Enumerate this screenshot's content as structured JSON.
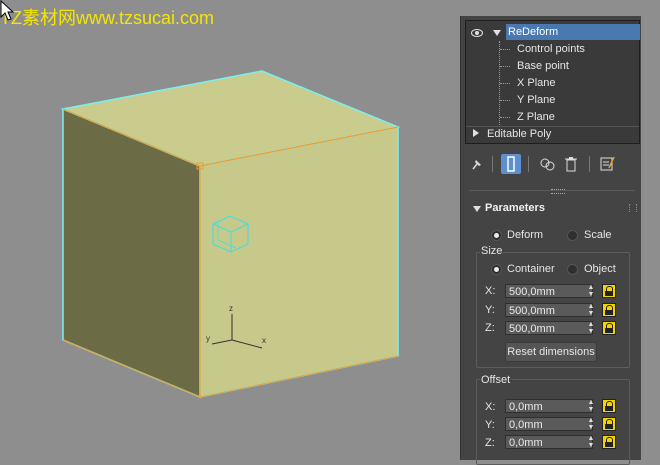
{
  "watermark": "TZ素材网www.tzsucai.com",
  "stack": {
    "modifier": "ReDeform",
    "subitems": [
      "Control points",
      "Base point",
      "X Plane",
      "Y Plane",
      "Z Plane"
    ],
    "base_object": "Editable Poly"
  },
  "toolbar": {
    "icons": [
      "pin-stack-icon",
      "show-end-result-icon",
      "make-unique-icon",
      "remove-modifier-icon",
      "configure-sets-icon"
    ]
  },
  "parameters": {
    "title": "Parameters",
    "mode_options": [
      "Deform",
      "Scale"
    ],
    "mode_selected": "Deform",
    "size": {
      "label": "Size",
      "options": [
        "Container",
        "Object"
      ],
      "selected": "Container",
      "x_label": "X:",
      "x_value": "500,0mm",
      "y_label": "Y:",
      "y_value": "500,0mm",
      "z_label": "Z:",
      "z_value": "500,0mm",
      "reset_label": "Reset dimensions"
    },
    "offset": {
      "label": "Offset",
      "x_label": "X:",
      "x_value": "0,0mm",
      "y_label": "Y:",
      "y_value": "0,0mm",
      "z_label": "Z:",
      "z_value": "0,0mm"
    }
  },
  "viewport": {
    "axis_labels": [
      "z",
      "x",
      "y"
    ],
    "colors": {
      "background": "#8e8e8e",
      "cube_front": "#c6c98a",
      "cube_top": "#c9cc8c",
      "cube_side": "#6b6c45",
      "selection_outline": "#79f0f0",
      "edge_highlight": "#f39b2a",
      "gizmo": "#3fe0e0"
    }
  }
}
